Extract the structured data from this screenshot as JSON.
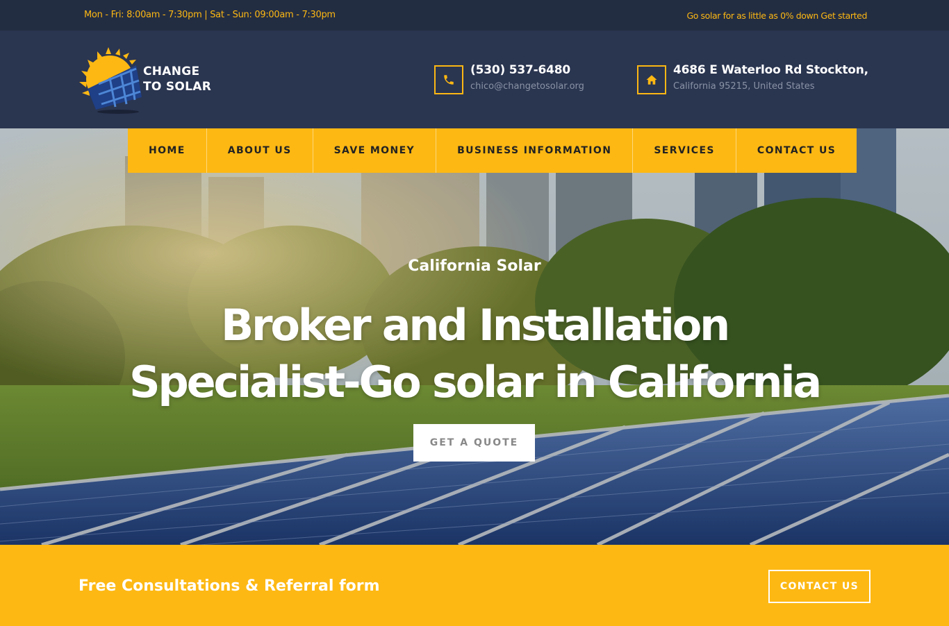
{
  "topbar": {
    "hours": "Mon - Fri: 8:00am - 7:30pm | Sat - Sun: 09:00am - 7:30pm",
    "promo": "Go solar for as little as 0% down Get started"
  },
  "brand": {
    "line1": "CHANGE",
    "line2": "TO SOLAR"
  },
  "contact": {
    "phone": "(530) 537-6480",
    "email": "chico@changetosolar.org",
    "address_line1": "4686 E Waterloo Rd Stockton,",
    "address_line2": "California 95215, United States"
  },
  "nav": {
    "items": [
      {
        "label": "HOME"
      },
      {
        "label": "ABOUT US"
      },
      {
        "label": "SAVE MONEY"
      },
      {
        "label": "BUSINESS INFORMATION"
      },
      {
        "label": "SERVICES"
      },
      {
        "label": "CONTACT US"
      }
    ]
  },
  "hero": {
    "kicker": "California Solar",
    "title_line1": "Broker and Installation",
    "title_line2": "Specialist-Go solar in California",
    "button": "GET A QUOTE"
  },
  "cta": {
    "text": "Free Consultations & Referral form",
    "button": "CONTACT US"
  },
  "icons": {
    "phone": "phone-icon",
    "home": "home-icon",
    "logo": "sun-solar-panel-logo"
  },
  "colors": {
    "accent": "#fdb813",
    "dark": "#2a3550",
    "topbar": "#232d42"
  }
}
